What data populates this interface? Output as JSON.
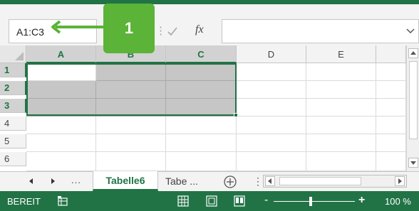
{
  "formula_bar": {
    "name_box_value": "A1:C3",
    "separator_glyph": "⋮",
    "fx_label": "fx",
    "formula_value": ""
  },
  "callout": {
    "number": "1",
    "color": "#5bb337"
  },
  "grid": {
    "columns": [
      "A",
      "B",
      "C",
      "D",
      "E"
    ],
    "rows": [
      "1",
      "2",
      "3",
      "4",
      "5",
      "6"
    ],
    "selected_range": "A1:C3",
    "accent_color": "#217346"
  },
  "sheet_tabs": {
    "overflow_label": "...",
    "active_tab": "Tabelle6",
    "other_tab": "Tabe ...",
    "menu_glyph": "⋮"
  },
  "status_bar": {
    "status_text": "BEREIT",
    "zoom_minus": "-",
    "zoom_plus": "+",
    "zoom_level": "100 %",
    "zoom_fraction": 0.46
  },
  "icons": {
    "name_box_arrow": "arrow-left-icon",
    "cancel": "close-icon",
    "confirm": "check-icon",
    "function": "fx-icon",
    "expand": "chevron-down-icon",
    "add_sheet": "plus-circle-icon",
    "macro": "macro-recorder-icon",
    "view_normal": "grid-view-icon",
    "view_page_layout": "page-layout-icon",
    "view_page_break": "page-break-icon"
  }
}
